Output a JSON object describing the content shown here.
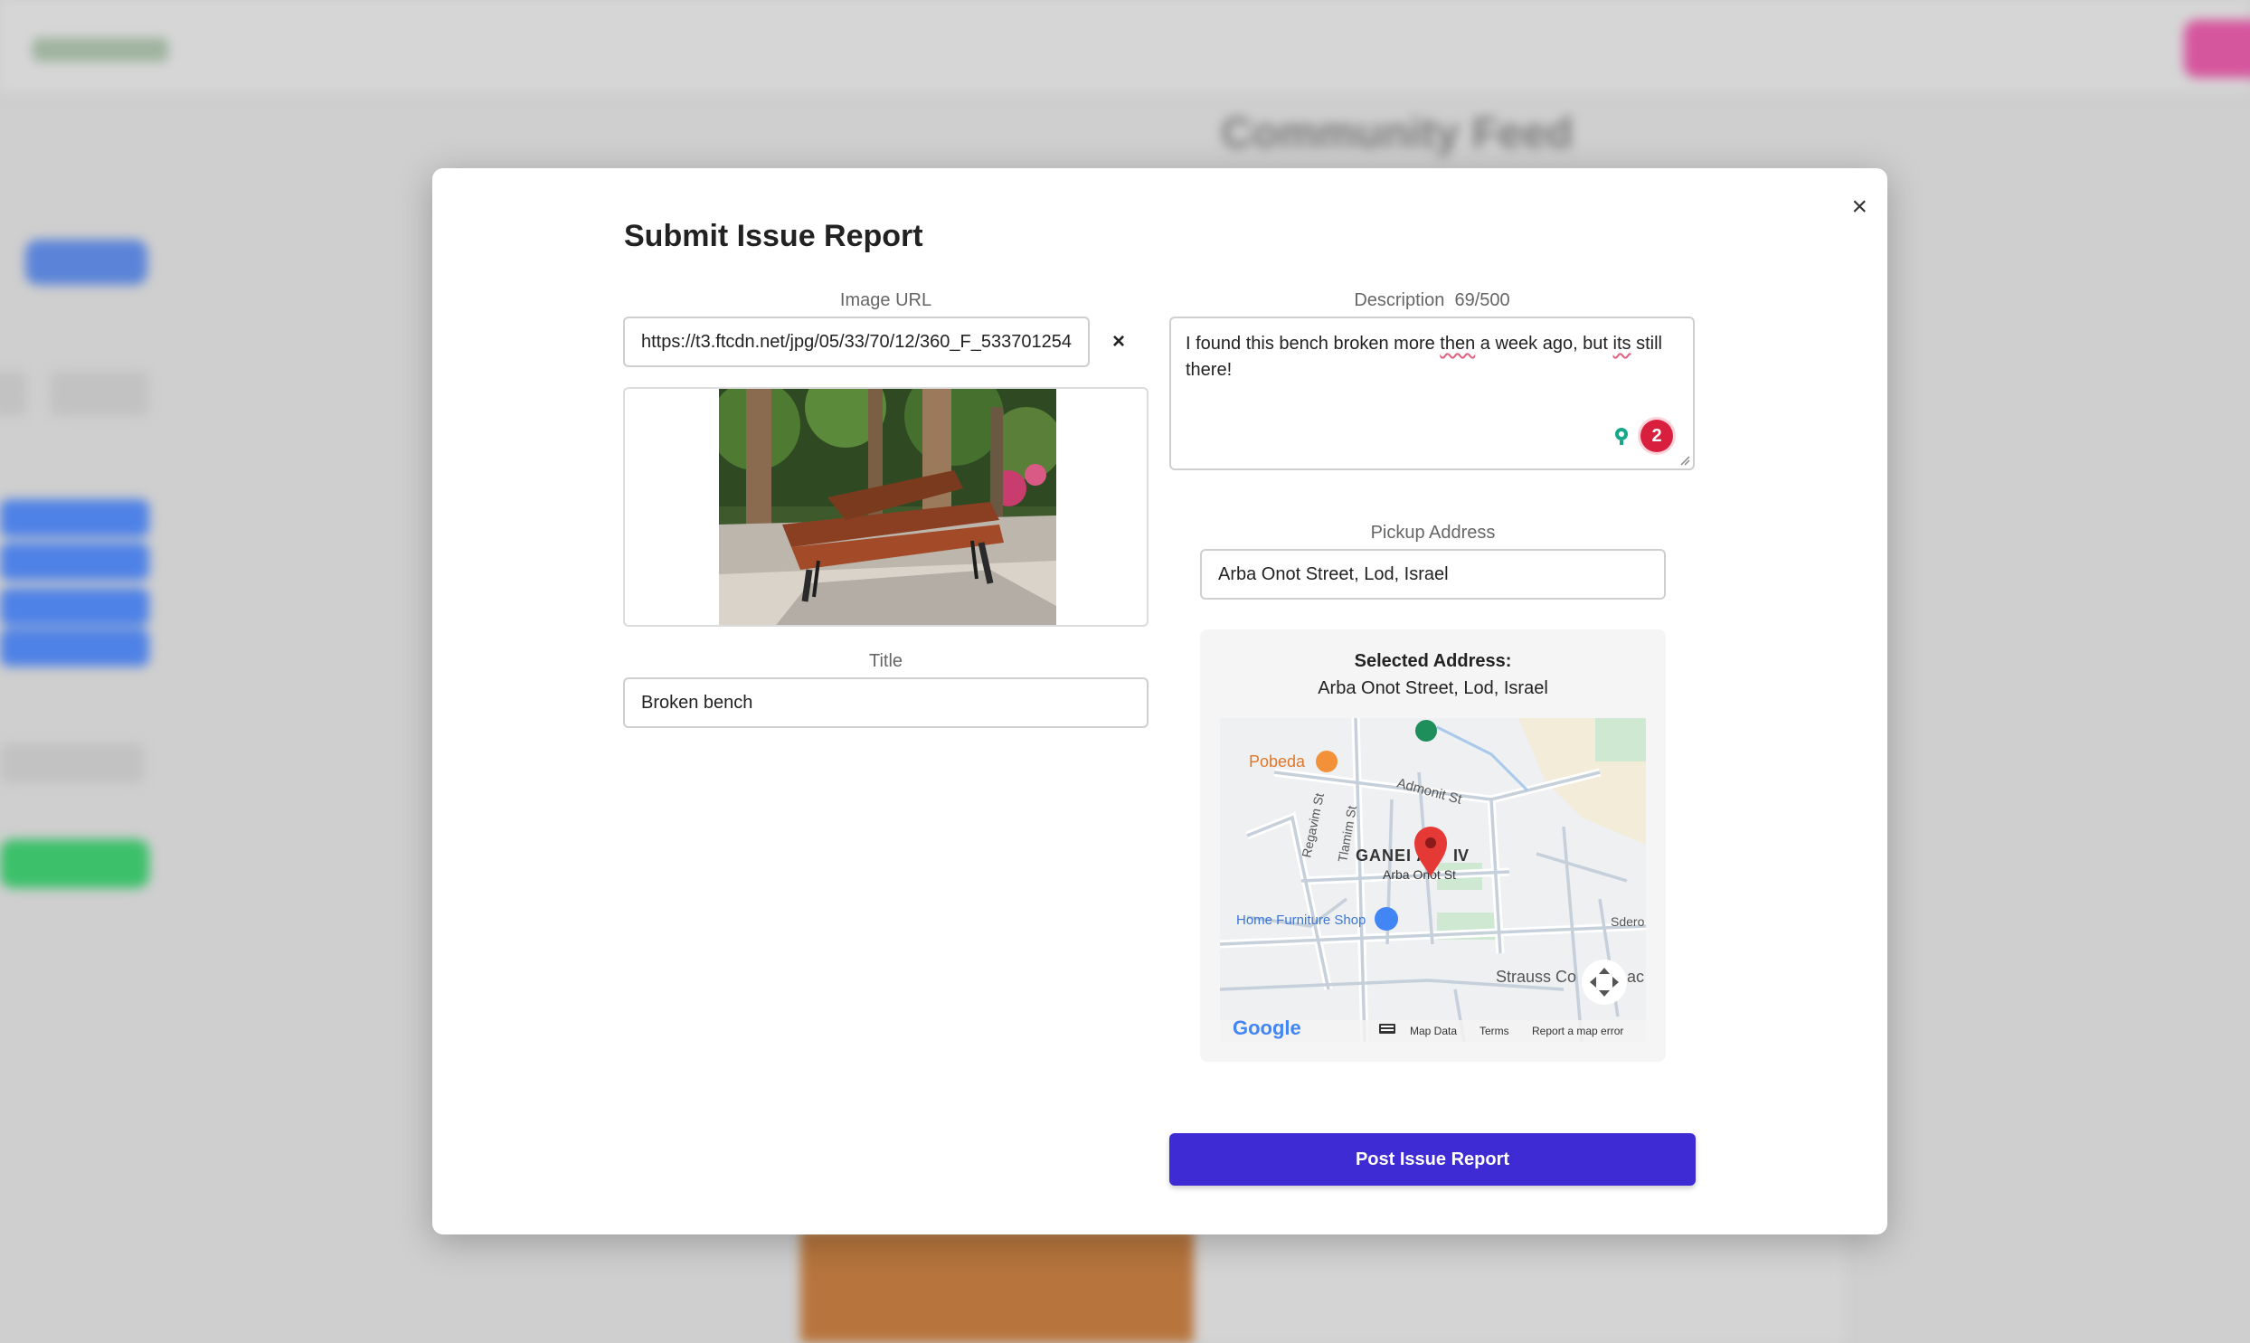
{
  "modal": {
    "title": "Submit Issue Report",
    "close_label": "×",
    "clear_label": "×",
    "image_url": {
      "label": "Image URL",
      "value": "https://t3.ftcdn.net/jpg/05/33/70/12/360_F_533701254"
    },
    "title_field": {
      "label": "Title",
      "value": "Broken bench"
    },
    "description": {
      "label": "Description",
      "counter": "69/500",
      "text_parts": [
        "I found this bench broken more ",
        "then",
        " a week ago, but ",
        "its",
        " still there!"
      ],
      "issue_count": "2"
    },
    "pickup": {
      "label": "Pickup Address",
      "value": "Arba Onot Street, Lod, Israel"
    },
    "selected": {
      "heading": "Selected Address:",
      "address": "Arba Onot Street, Lod, Israel"
    },
    "map": {
      "labels": {
        "pobeda": "Pobeda",
        "admonit": "Admonit St",
        "regavim": "Regavim St",
        "tlamim": "Tlamim St",
        "ganei": "GANEI AV",
        "ganei_end": "IV",
        "arba": "Arba Onot St",
        "furniture": "Home Furniture Shop",
        "sderot": "Sdero",
        "strauss": "Strauss Co",
        "strauss_end": "ac"
      },
      "google": "Google",
      "footer": {
        "map_data": "Map Data",
        "terms": "Terms",
        "report": "Report a map error"
      }
    },
    "submit_label": "Post Issue Report"
  },
  "background": {
    "page_title": "Community Feed"
  },
  "colors": {
    "primary": "#3f2bd4",
    "badge": "#d8203e",
    "pin": "#e53935"
  }
}
